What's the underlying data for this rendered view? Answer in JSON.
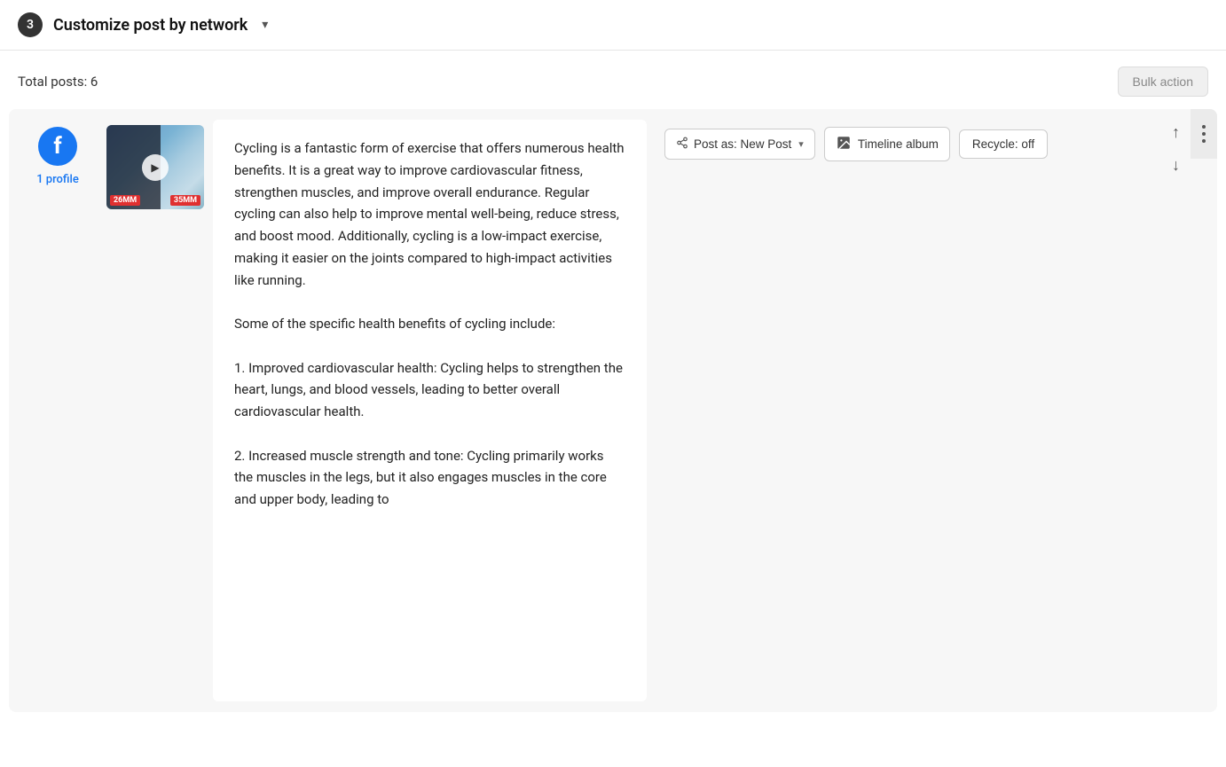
{
  "header": {
    "step_number": "3",
    "title": "Customize post by network",
    "chevron": "▾"
  },
  "toolbar": {
    "total_posts_label": "Total posts: 6",
    "bulk_action_label": "Bulk action"
  },
  "post_card": {
    "profile": {
      "icon_letter": "f",
      "profile_count_label": "1 profile"
    },
    "thumbnail": {
      "label_26mm": "26MM",
      "label_35mm": "35MM",
      "play_icon": "▶"
    },
    "content": {
      "paragraphs": [
        "Cycling is a fantastic form of exercise that offers numerous health benefits. It is a great way to improve cardiovascular fitness, strengthen muscles, and improve overall endurance. Regular cycling can also help to improve mental well-being, reduce stress, and boost mood. Additionally, cycling is a low-impact exercise, making it easier on the joints compared to high-impact activities like running.",
        "Some of the specific health benefits of cycling include:",
        "1. Improved cardiovascular health: Cycling helps to strengthen the heart, lungs, and blood vessels, leading to better overall cardiovascular health.",
        "2. Increased muscle strength and tone: Cycling primarily works the muscles in the legs, but it also engages muscles in the core and upper body, leading to"
      ]
    },
    "actions": {
      "post_as_label": "Post as: New Post",
      "post_as_dropdown": "▾",
      "timeline_album_label": "Timeline album",
      "recycle_label": "Recycle: off"
    },
    "nav": {
      "up_arrow": "↑",
      "down_arrow": "↓"
    }
  }
}
